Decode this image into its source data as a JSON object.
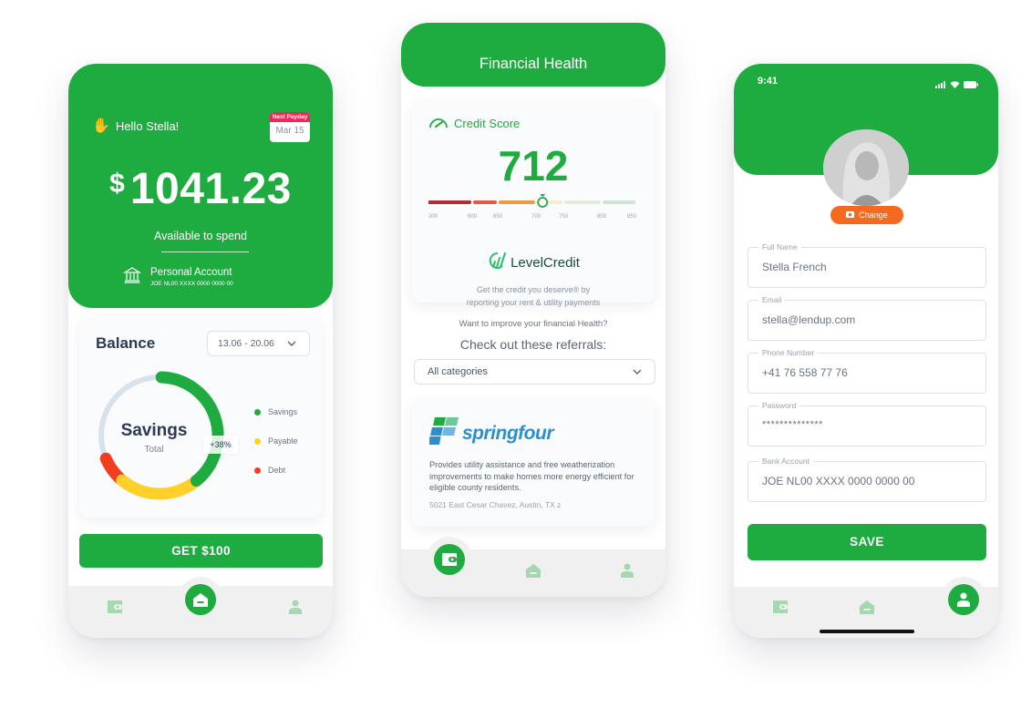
{
  "brand_color": "#1eab3f",
  "phone1": {
    "greeting": "Hello Stella!",
    "next_payday": {
      "label": "Next Payday",
      "date": "Mar 15"
    },
    "balance": {
      "currency": "$",
      "amount": "1041.23",
      "caption": "Available to spend"
    },
    "account": {
      "name": "Personal Account",
      "number": "JOE NL00 XXXX 0000 0000 00"
    },
    "balance_card": {
      "title": "Balance",
      "date_range": "13.06 - 20.06",
      "donut_title": "Savings",
      "donut_subtitle": "Total",
      "tooltip": "+38%",
      "legend": [
        {
          "label": "Savings",
          "color": "#1eab3f"
        },
        {
          "label": "Payable",
          "color": "#ffd02a"
        },
        {
          "label": "Debt",
          "color": "#f23d1e"
        }
      ],
      "segments": [
        {
          "name": "Savings",
          "fraction": 0.38,
          "color": "#1eab3f"
        },
        {
          "name": "Payable",
          "fraction": 0.22,
          "color": "#ffd02a"
        },
        {
          "name": "Debt",
          "fraction": 0.08,
          "color": "#f23d1e"
        },
        {
          "name": "Remaining",
          "fraction": 0.32,
          "color": "#d8e2ec"
        }
      ]
    },
    "cta": "GET $100",
    "active_tab": "home"
  },
  "phone2": {
    "title": "Financial Health",
    "credit_score": {
      "label": "Credit Score",
      "value": "712",
      "score_number": 712,
      "scale_ticks": [
        "300",
        "600",
        "650",
        "700",
        "750",
        "800",
        "850"
      ],
      "bands": [
        {
          "from": 300,
          "to": 600,
          "color": "#b03030"
        },
        {
          "from": 600,
          "to": 650,
          "color": "#e55a3a"
        },
        {
          "from": 650,
          "to": 700,
          "color": "#ee9a40"
        },
        {
          "from": 700,
          "to": 750,
          "color": "#f5edc8"
        },
        {
          "from": 750,
          "to": 800,
          "color": "#e3ecdc"
        },
        {
          "from": 800,
          "to": 850,
          "color": "#cfe3d6"
        }
      ]
    },
    "partner": {
      "name": "LevelCredit",
      "tagline_line1": "Get the credit you deserve® by",
      "tagline_line2": "reporting your rent & utility payments"
    },
    "prompt": "Want  to improve your financial Health?",
    "referrals_heading": "Check out these referrals:",
    "category_select": "All categories",
    "referral": {
      "name": "springfour",
      "description": "Provides utility assistance and free weatherization improvements to make homes more energy efficient for eligible county residents.",
      "address": "5021 East Cesar Chavez, Austin, TX z"
    },
    "active_tab": "wallet"
  },
  "phone3": {
    "status_time": "9:41",
    "change_photo": "Change",
    "fields": [
      {
        "label": "Full Name",
        "value": "Stella French"
      },
      {
        "label": "Email",
        "value": "stella@lendup.com"
      },
      {
        "label": "Phone Number",
        "value": "+41 76 558 77 76"
      },
      {
        "label": "Password",
        "value": "**************"
      },
      {
        "label": "Bank Account",
        "value": "JOE NL00 XXXX 0000 0000 00"
      }
    ],
    "save": "SAVE",
    "active_tab": "profile"
  }
}
